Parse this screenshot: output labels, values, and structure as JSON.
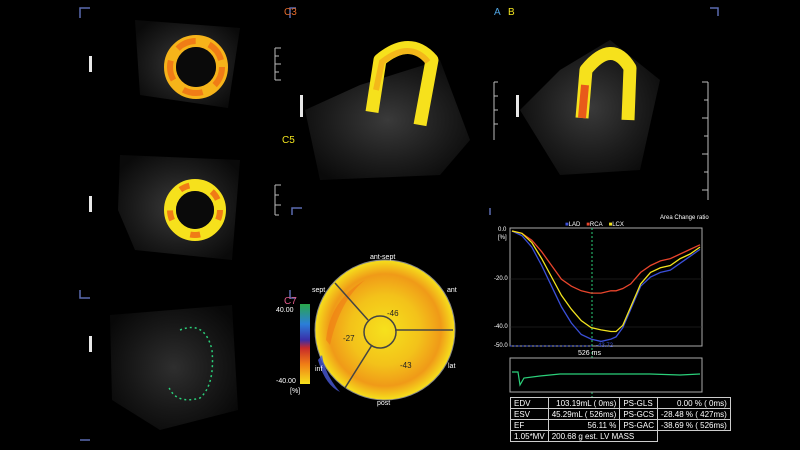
{
  "viewport_labels": {
    "c3": "C3",
    "c5": "C5",
    "c7": "C7",
    "a": "A",
    "b": "B"
  },
  "bullseye": {
    "labels": {
      "ant_sept": "ant-sept",
      "sept": "sept",
      "ant": "ant",
      "inf": "inf",
      "lat": "lat",
      "post": "post"
    },
    "values": {
      "ant": "-46",
      "sept": "-27",
      "lat": "-43"
    },
    "scale": {
      "max": "40.00",
      "min": "-40.00",
      "unit": "[%]"
    }
  },
  "graph": {
    "title": "Area Change ratio",
    "legend": [
      "LAD",
      "RCA",
      "LCX"
    ],
    "y_unit": "[%]",
    "y_ticks": [
      "0.0",
      "-20.0",
      "-40.0",
      "-50.0"
    ],
    "marker_label": "526 ms",
    "peak_value": "-43.72"
  },
  "chart_data": {
    "type": "line",
    "title": "Area Change ratio",
    "ylabel": "[%]",
    "ylim": [
      -50,
      0
    ],
    "x": [
      0,
      50,
      100,
      150,
      200,
      250,
      300,
      350,
      400,
      450,
      500,
      526,
      560,
      600,
      650,
      700,
      750,
      800,
      850,
      900,
      950
    ],
    "series": [
      {
        "name": "LAD",
        "color": "#3a4fd8",
        "values": [
          0,
          -2,
          -7,
          -15,
          -24,
          -33,
          -40,
          -45,
          -47,
          -48,
          -47,
          -46,
          -42,
          -34,
          -24,
          -20,
          -18,
          -17,
          -14,
          -11,
          -8
        ]
      },
      {
        "name": "RCA",
        "color": "#e8452c",
        "values": [
          0,
          -1,
          -4,
          -9,
          -15,
          -21,
          -24,
          -26,
          -27,
          -27,
          -26,
          -26,
          -25,
          -23,
          -18,
          -15,
          -13,
          -12,
          -10,
          -8,
          -6
        ]
      },
      {
        "name": "LCX",
        "color": "#f2e41e",
        "values": [
          0,
          -1,
          -5,
          -12,
          -20,
          -28,
          -34,
          -39,
          -42,
          -43,
          -43.7,
          -43.7,
          -41,
          -33,
          -23,
          -18,
          -16,
          -15,
          -12,
          -10,
          -7
        ]
      }
    ]
  },
  "stats": [
    [
      "EDV",
      "103.19mL",
      "( 0ms)",
      "PS-GLS",
      "0.00 %",
      "( 0ms)"
    ],
    [
      "ESV",
      "45.29mL",
      "( 526ms)",
      "PS-GCS",
      "-28.48 %",
      "( 427ms)"
    ],
    [
      "EF",
      "56.11 %",
      "",
      "PS-GAC",
      "-38.69 %",
      "( 526ms)"
    ],
    [
      "1.05*MV",
      "200.68 g",
      "est. LV MASS",
      "",
      "",
      ""
    ]
  ],
  "colors": {
    "bg": "#000000",
    "frame": "#5a6bb0",
    "strain_ring": "#f6e11c",
    "strain_hot": "#f07c16",
    "label_c3": "#e26a2c",
    "label_c5": "#f2e41e",
    "label_c7": "#e05a8a",
    "label_a": "#4fa3e0",
    "label_b": "#f2e41e"
  }
}
